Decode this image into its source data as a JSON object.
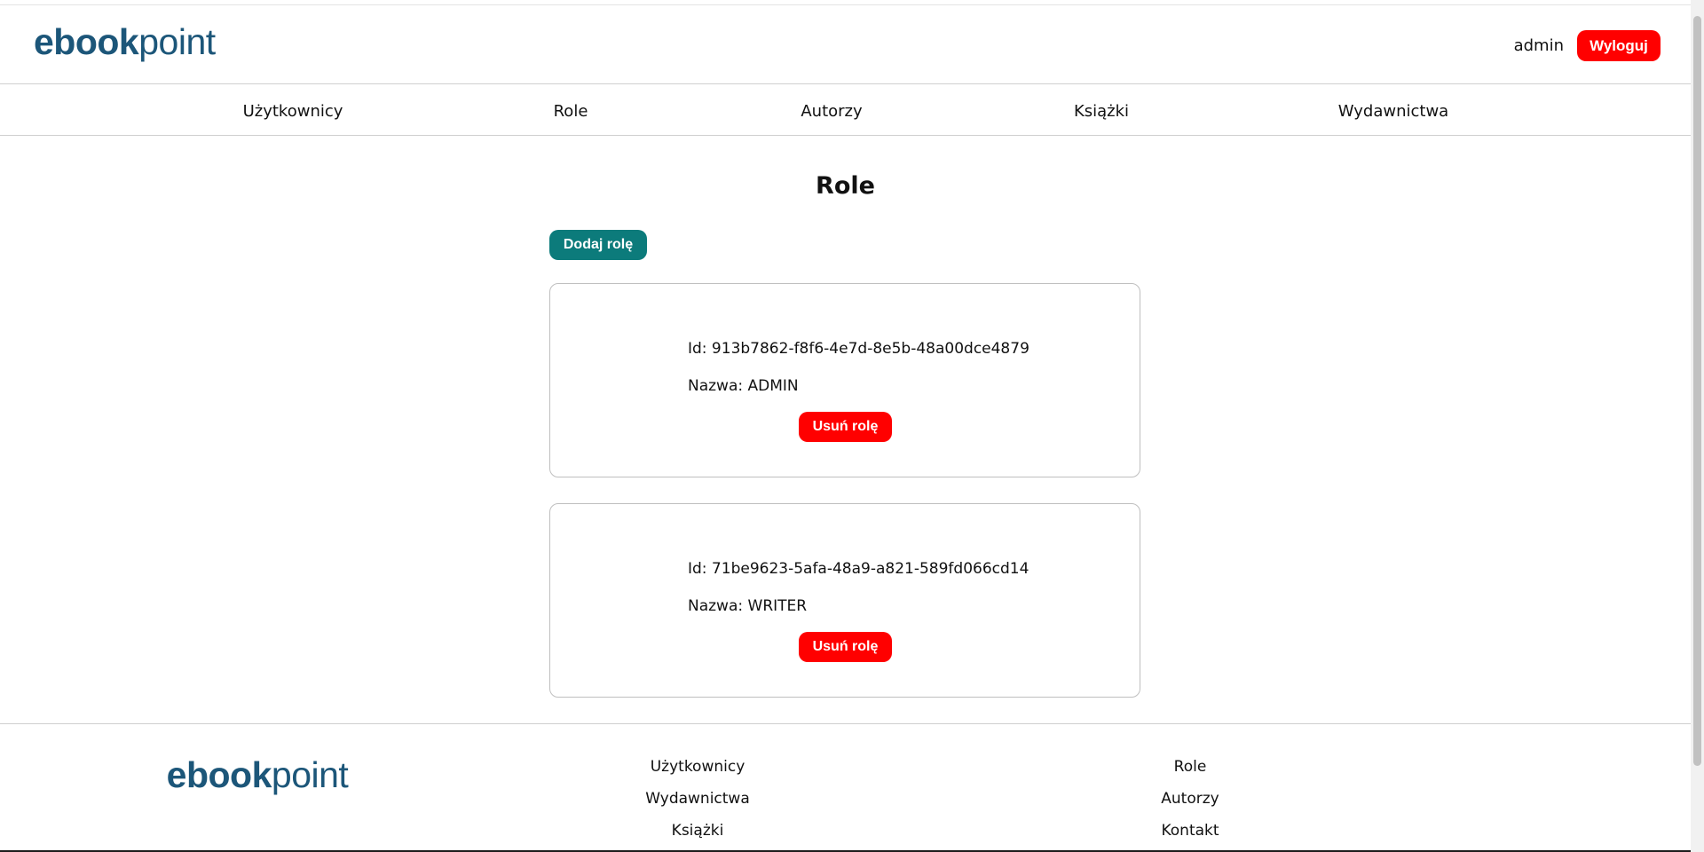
{
  "brand": {
    "part1": "ebook",
    "part2": "point"
  },
  "header": {
    "username": "admin",
    "logout_label": "Wyloguj"
  },
  "nav": {
    "items": [
      "Użytkownicy",
      "Role",
      "Autorzy",
      "Książki",
      "Wydawnictwa"
    ]
  },
  "page": {
    "title": "Role",
    "add_button": "Dodaj rolę"
  },
  "roles": [
    {
      "id_text": "Id: 913b7862-f8f6-4e7d-8e5b-48a00dce4879",
      "name_text": "Nazwa: ADMIN",
      "delete_label": "Usuń rolę"
    },
    {
      "id_text": "Id: 71be9623-5afa-48a9-a821-589fd066cd14",
      "name_text": "Nazwa: WRITER",
      "delete_label": "Usuń rolę"
    }
  ],
  "footer": {
    "col1": [
      "Użytkownicy",
      "Wydawnictwa",
      "Książki"
    ],
    "col2": [
      "Role",
      "Autorzy",
      "Kontakt"
    ]
  },
  "colors": {
    "brand": "#1c5679",
    "danger": "#ff0000",
    "primary": "#0c7b7b"
  }
}
